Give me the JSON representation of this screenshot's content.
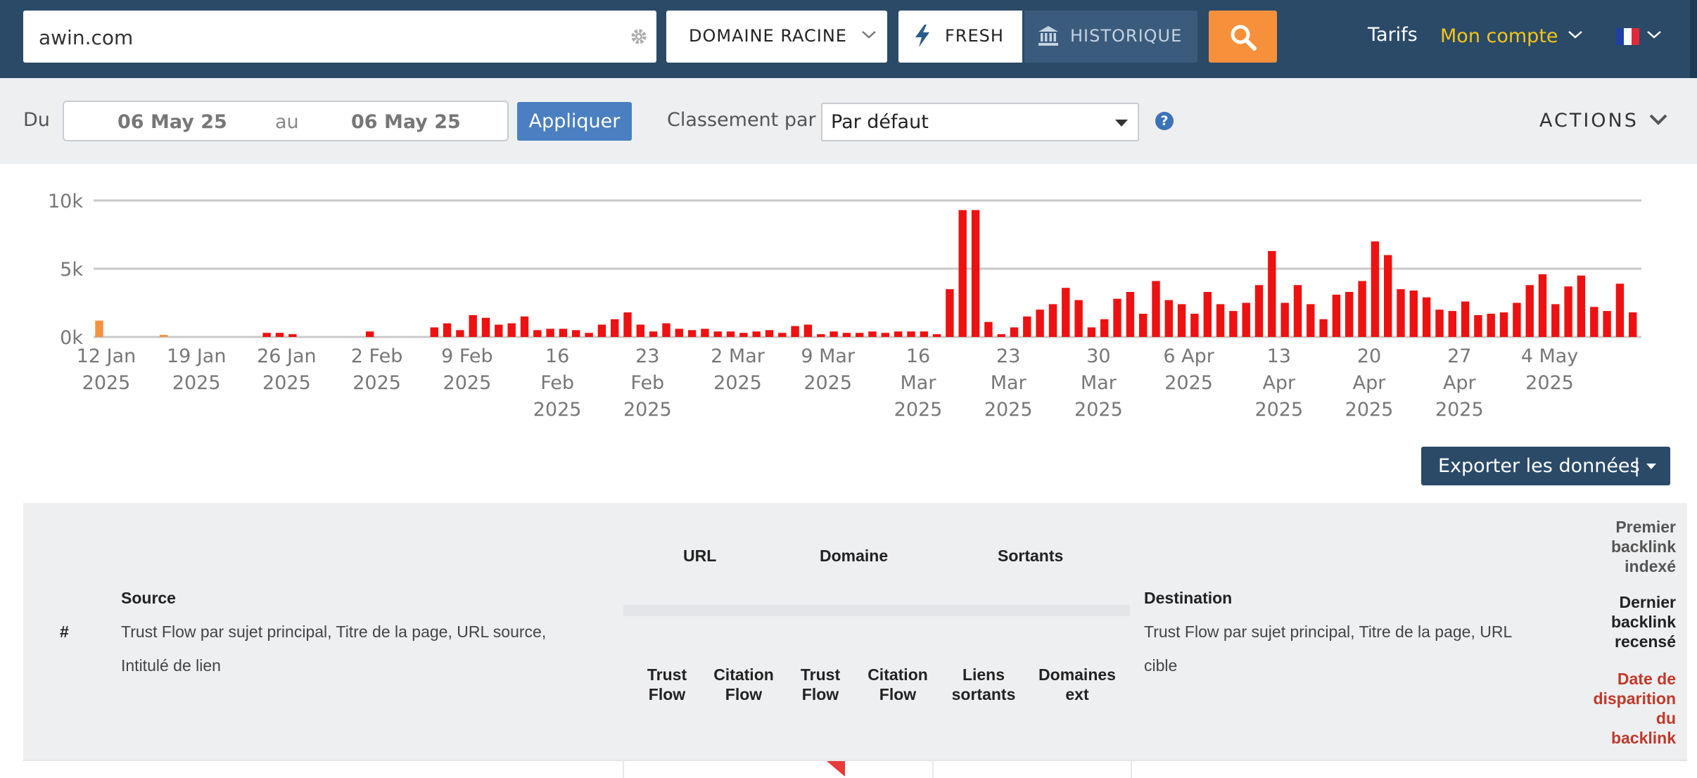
{
  "search": {
    "value": "awin.com",
    "scope": "DOMAINE RACINE",
    "fresh": "FRESH",
    "history": "HISTORIQUE"
  },
  "nav": {
    "pricing": "Tarifs",
    "account": "Mon compte"
  },
  "filters": {
    "from_label": "Du",
    "from_date": "06 May 25",
    "to_label": "au",
    "to_date": "06 May 25",
    "apply": "Appliquer",
    "sort_label": "Classement par",
    "sort_value": "Par défaut",
    "help": "?",
    "actions": "ACTIONS"
  },
  "chart_data": {
    "type": "bar",
    "ylim": [
      0,
      10000
    ],
    "yticks": [
      "0k",
      "5k",
      "10k"
    ],
    "xticks": [
      [
        "12 Jan",
        "2025"
      ],
      [
        "19 Jan",
        "2025"
      ],
      [
        "26 Jan",
        "2025"
      ],
      [
        "2 Feb",
        "2025"
      ],
      [
        "9 Feb",
        "2025"
      ],
      [
        "16",
        "Feb",
        "2025"
      ],
      [
        "23",
        "Feb",
        "2025"
      ],
      [
        "2 Mar",
        "2025"
      ],
      [
        "9 Mar",
        "2025"
      ],
      [
        "16",
        "Mar",
        "2025"
      ],
      [
        "23",
        "Mar",
        "2025"
      ],
      [
        "30",
        "Mar",
        "2025"
      ],
      [
        "6 Apr",
        "2025"
      ],
      [
        "13",
        "Apr",
        "2025"
      ],
      [
        "20",
        "Apr",
        "2025"
      ],
      [
        "27",
        "Apr",
        "2025"
      ],
      [
        "4 May",
        "2025"
      ]
    ],
    "highlight_color": "#f5923e",
    "bar_color": "#ee1111",
    "values": [
      1200,
      0,
      0,
      0,
      0,
      150,
      0,
      0,
      0,
      0,
      0,
      0,
      0,
      300,
      300,
      200,
      0,
      0,
      0,
      0,
      0,
      400,
      0,
      0,
      0,
      0,
      700,
      1000,
      500,
      1600,
      1400,
      900,
      1000,
      1500,
      500,
      600,
      600,
      500,
      300,
      900,
      1300,
      1800,
      900,
      400,
      1000,
      600,
      500,
      600,
      400,
      400,
      300,
      400,
      500,
      300,
      800,
      900,
      200,
      400,
      300,
      300,
      400,
      300,
      400,
      400,
      400,
      200,
      3500,
      9300,
      9300,
      1100,
      200,
      700,
      1500,
      2000,
      2400,
      3600,
      2700,
      700,
      1300,
      2800,
      3300,
      1700,
      4100,
      2700,
      2400,
      1700,
      3300,
      2400,
      1900,
      2500,
      3800,
      6300,
      2500,
      3800,
      2400,
      1300,
      3100,
      3300,
      4100,
      7000,
      6000,
      3500,
      3400,
      2900,
      2000,
      1900,
      2600,
      1600,
      1700,
      1800,
      2500,
      3800,
      4600,
      2400,
      3700,
      4500,
      2200,
      1900,
      3900,
      1800
    ],
    "highlight_count": 6
  },
  "export": {
    "label": "Exporter les données",
    "sep": "|"
  },
  "table": {
    "hash": "#",
    "source_title": "Source",
    "source_sub_1": "Trust Flow par sujet principal, Titre de la page, URL source,",
    "source_sub_2": "Intitulé de lien",
    "group_url": "URL",
    "group_domain": "Domaine",
    "group_outgoing": "Sortants",
    "url_tf": [
      "Trust",
      "Flow"
    ],
    "url_cf": [
      "Citation",
      "Flow"
    ],
    "dom_tf": [
      "Trust",
      "Flow"
    ],
    "dom_cf": [
      "Citation",
      "Flow"
    ],
    "out_links": [
      "Liens",
      "sortants"
    ],
    "out_domains": [
      "Domaines",
      "ext"
    ],
    "dest_title": "Destination",
    "dest_sub_1": "Trust Flow par sujet principal, Titre de la page, URL",
    "dest_sub_2": "cible",
    "first_seen": [
      "Premier",
      "backlink",
      "indexé"
    ],
    "last_seen": [
      "Dernier",
      "backlink",
      "recensé"
    ],
    "lost": [
      "Date de",
      "disparition",
      "du",
      "backlink"
    ],
    "lost_color": "#c0392b"
  }
}
